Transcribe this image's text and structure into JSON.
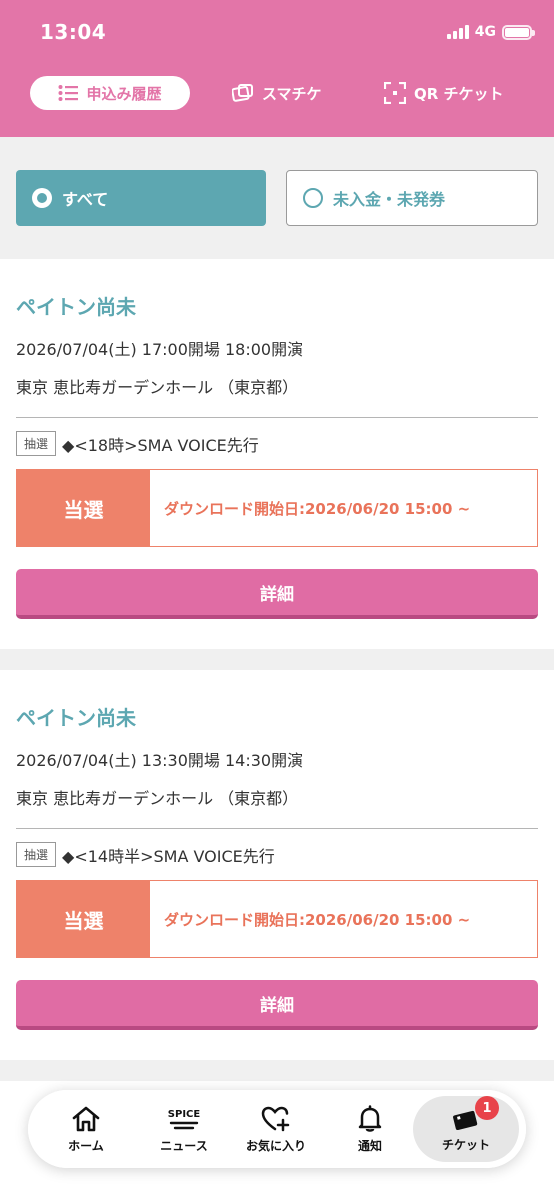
{
  "status_bar": {
    "time": "13:04",
    "network": "4G"
  },
  "tabs": [
    {
      "label": "申込み履歴",
      "active": true
    },
    {
      "label": "スマチケ",
      "active": false
    },
    {
      "label": "QR チケット",
      "active": false
    }
  ],
  "filters": {
    "all_label": "すべて",
    "unpaid_label": "未入金・未発券"
  },
  "cards": [
    {
      "title": "ペイトン尚未",
      "datetime": "2026/07/04(土) 17:00開場 18:00開演",
      "venue": "東京 恵比寿ガーデンホール （東京都）",
      "lottery_badge": "抽選",
      "lottery_name": "◆<18時>SMA VOICE先行",
      "status": "当選",
      "download": "ダウンロード開始日:2026/06/20 15:00 ~",
      "detail_label": "詳細"
    },
    {
      "title": "ペイトン尚未",
      "datetime": "2026/07/04(土) 13:30開場 14:30開演",
      "venue": "東京 恵比寿ガーデンホール （東京都）",
      "lottery_badge": "抽選",
      "lottery_name": "◆<14時半>SMA VOICE先行",
      "status": "当選",
      "download": "ダウンロード開始日:2026/06/20 15:00 ~",
      "detail_label": "詳細"
    }
  ],
  "bottom_nav": {
    "home": "ホーム",
    "news": "ニュース",
    "news_icon_text": "SPICE",
    "favorites": "お気に入り",
    "notifications": "通知",
    "ticket": "チケット",
    "ticket_badge": "1"
  },
  "colors": {
    "header": "#e375a8",
    "teal": "#5da7b1",
    "status": "#ee826a",
    "button": "#e06ca4"
  }
}
